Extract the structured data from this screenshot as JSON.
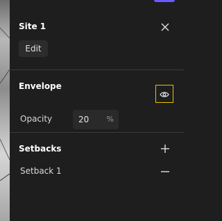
{
  "site": {
    "title": "Site 1",
    "edit_label": "Edit",
    "close_icon": "close-icon"
  },
  "envelope": {
    "title": "Envelope",
    "visibility_icon": "eye-icon",
    "highlight_color": "#e8c400",
    "opacity": {
      "label": "Opacity",
      "value": "20",
      "unit": "%"
    }
  },
  "setbacks": {
    "title": "Setbacks",
    "add_icon": "plus-icon",
    "items": [
      {
        "label": "Setback 1",
        "remove_icon": "minus-icon"
      }
    ]
  },
  "colors": {
    "accent": "#6b5bff",
    "panel_bg": "#1e1e1e"
  }
}
